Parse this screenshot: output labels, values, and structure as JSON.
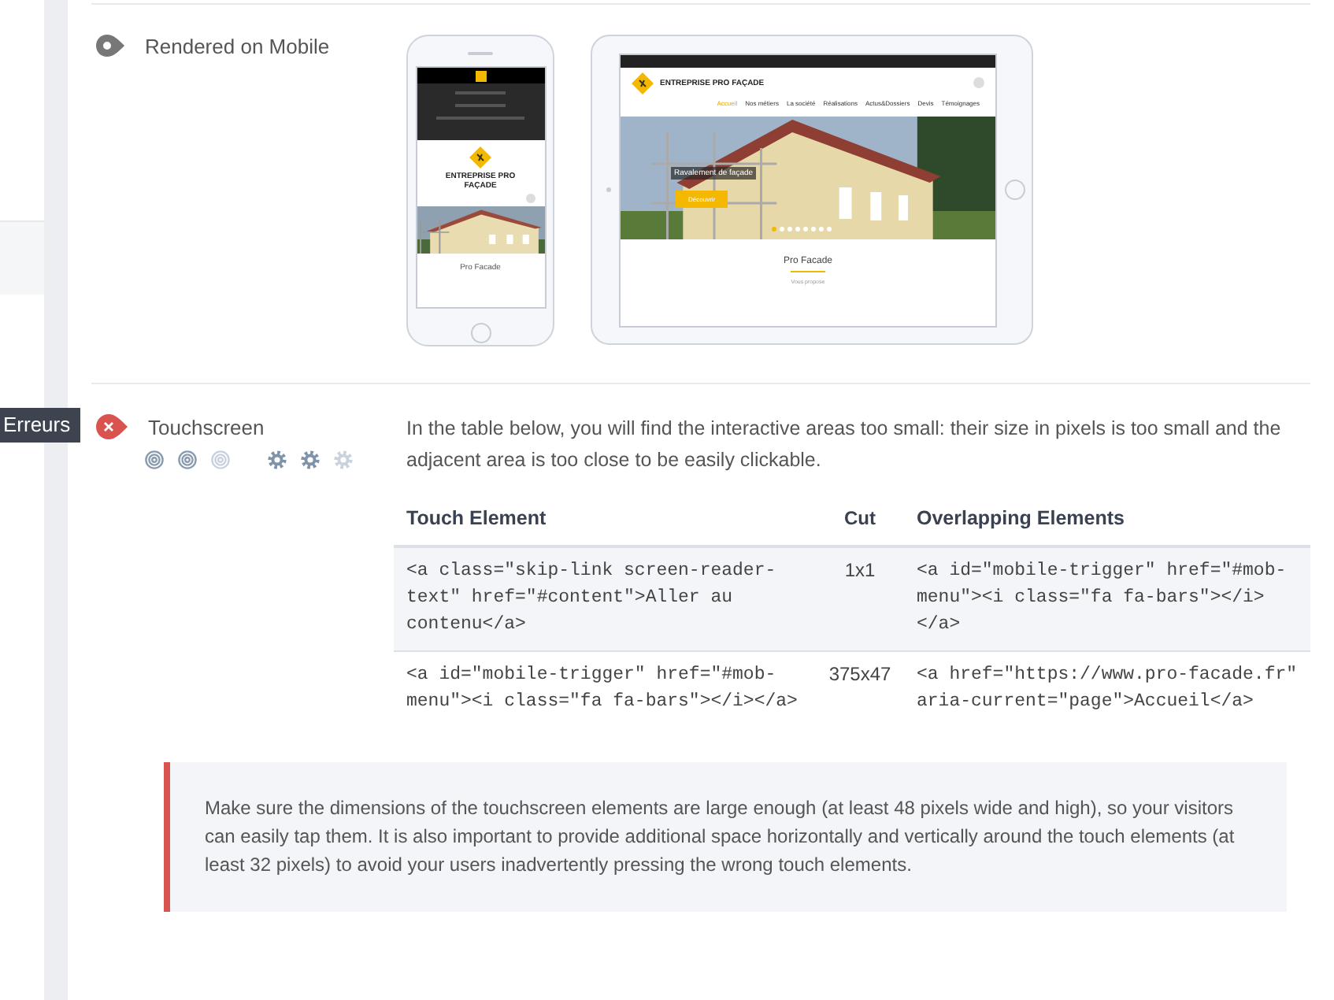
{
  "mobile_render": {
    "title": "Rendered on Mobile",
    "phone": {
      "brand": "ENTREPRISE PRO FAÇADE",
      "heading": "Pro Facade"
    },
    "tablet": {
      "brand": "ENTREPRISE PRO FAÇADE",
      "nav": [
        {
          "label": "Accueil",
          "selected": true
        },
        {
          "label": "Nos métiers",
          "selected": false
        },
        {
          "label": "La société",
          "selected": false
        },
        {
          "label": "Réalisations",
          "selected": false
        },
        {
          "label": "Actus&Dossiers",
          "selected": false
        },
        {
          "label": "Devis",
          "selected": false
        },
        {
          "label": "Témoignages",
          "selected": false
        }
      ],
      "slide_title": "Ravalement de façade",
      "slide_button": "Découvrir",
      "slide_dots": [
        {
          "selected": true
        },
        {
          "selected": false
        },
        {
          "selected": false
        },
        {
          "selected": false
        },
        {
          "selected": false
        },
        {
          "selected": false
        },
        {
          "selected": false
        },
        {
          "selected": false
        }
      ],
      "heading": "Pro Facade",
      "subheading": "Vous propose"
    }
  },
  "touchscreen": {
    "error": true,
    "tooltip": "Erreurs",
    "title": "Touchscreen",
    "targets": [
      {
        "on": true
      },
      {
        "on": true
      },
      {
        "on": false
      }
    ],
    "gears": [
      {
        "on": true
      },
      {
        "on": true
      },
      {
        "on": false
      }
    ],
    "description": "In the table below, you will find the interactive areas too small: their size in pixels is too small and the adjacent area is too close to be easily clickable.",
    "table": {
      "columns": [
        "Touch Element",
        "Cut",
        "Overlapping Elements"
      ],
      "rows": [
        [
          "<a class=\"skip-link screen-reader-text\" href=\"#content\">Aller au contenu</a>",
          "1x1",
          "<a id=\"mobile-trigger\" href=\"#mob-menu\"><i class=\"fa fa-bars\"></i></a>"
        ],
        [
          "<a id=\"mobile-trigger\" href=\"#mob-menu\"><i class=\"fa fa-bars\"></i></a>",
          "375x47",
          "<a href=\"https://www.pro-facade.fr\" aria-current=\"page\">Accueil</a>"
        ]
      ]
    },
    "advice": "Make sure the dimensions of the touchscreen elements are large enough (at least 48 pixels wide and high), so your visitors can easily tap them. It is also important to provide additional space horizontally and vertically around the touch elements (at least 32 pixels) to avoid your users inadvertently pressing the wrong touch elements."
  }
}
